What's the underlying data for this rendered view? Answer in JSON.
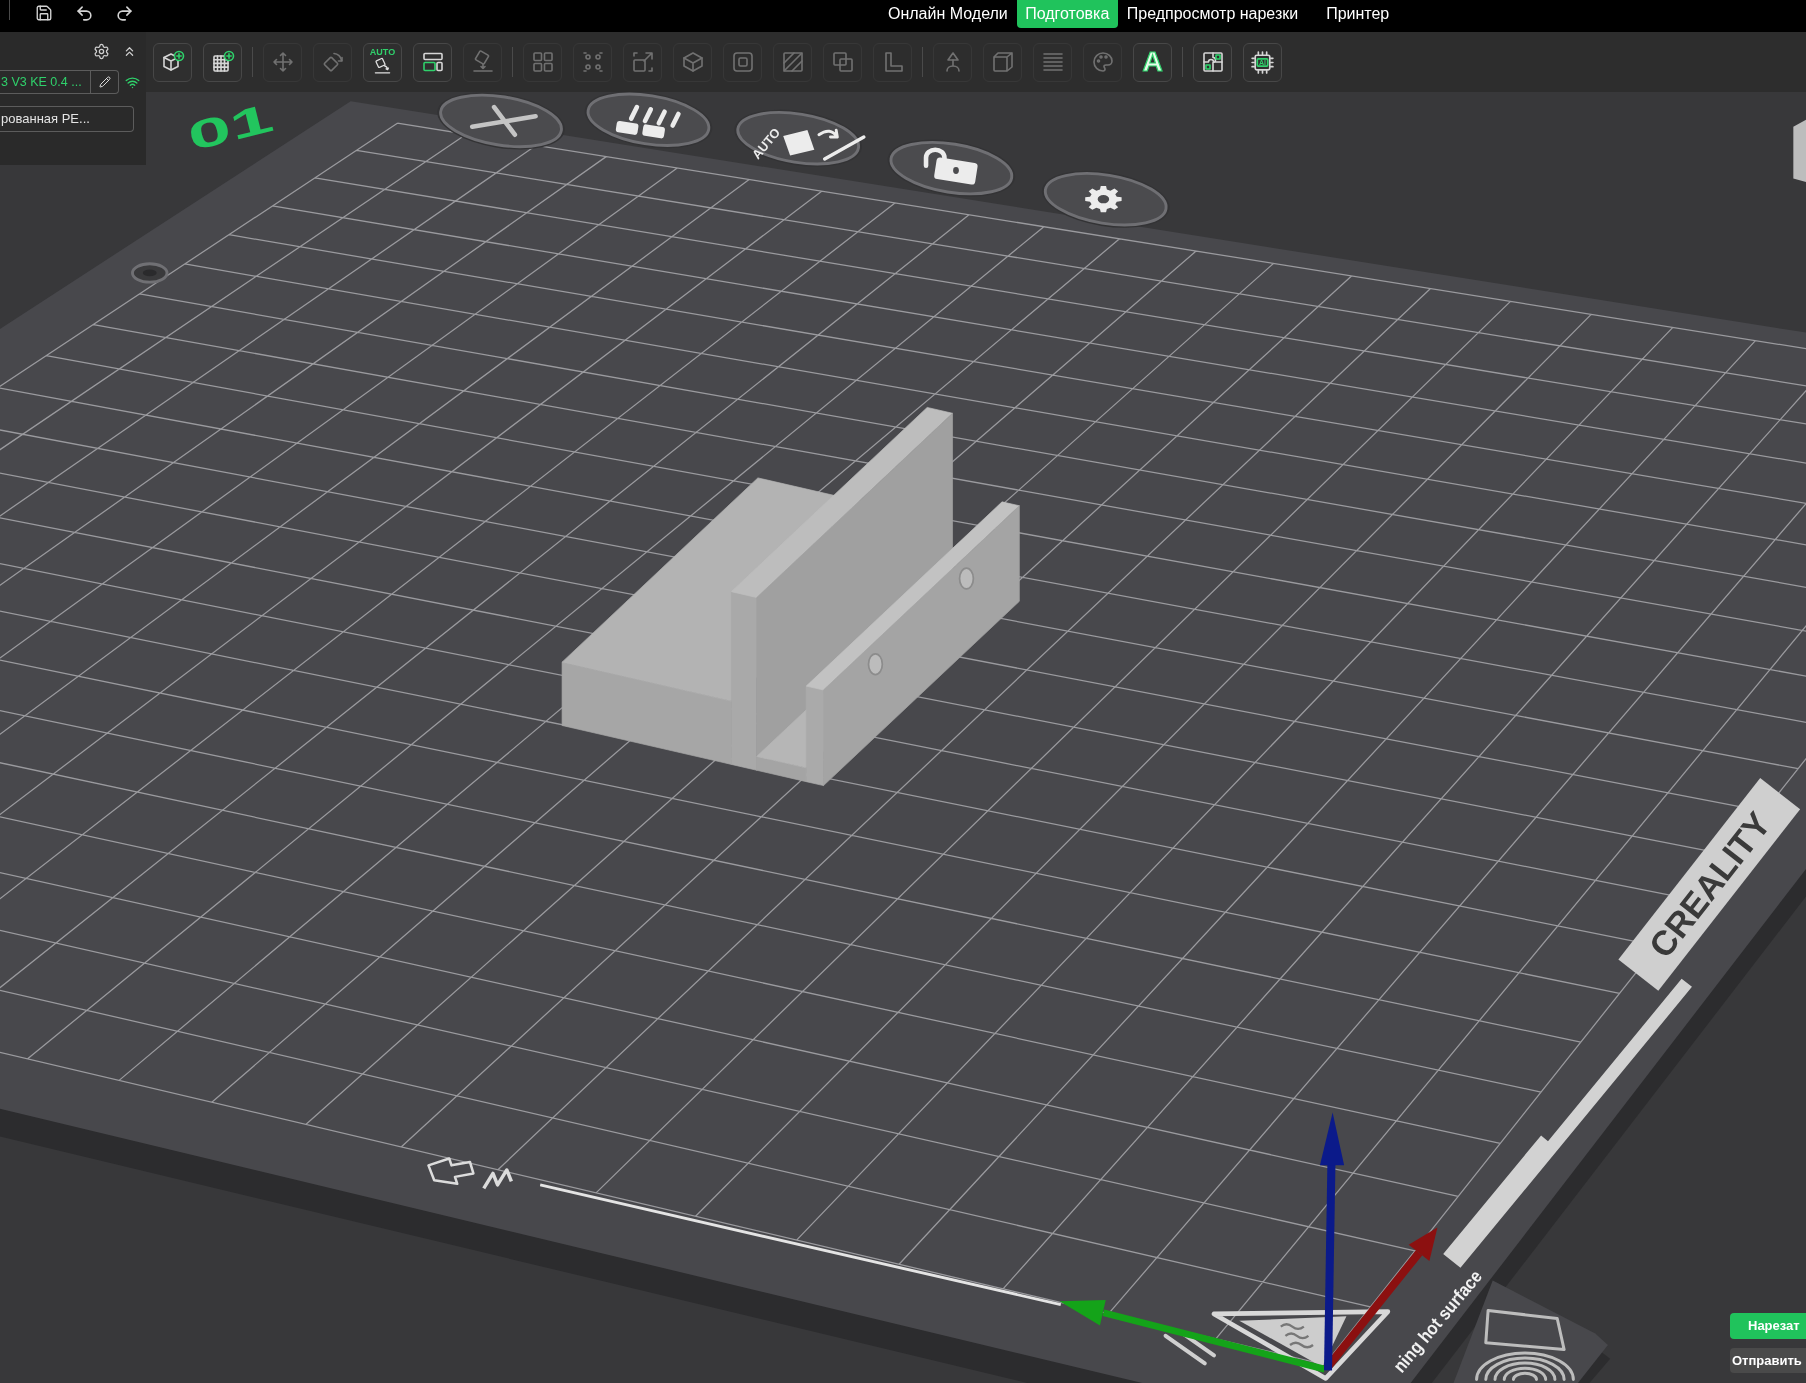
{
  "top_bar": {
    "tabs": [
      {
        "label": "Онлайн Модели",
        "selected": false
      },
      {
        "label": "Подготовка",
        "selected": true
      },
      {
        "label": "Предпросмотр нарезки",
        "selected": false
      },
      {
        "label": "Принтер",
        "selected": false
      }
    ]
  },
  "printer_panel": {
    "printer_name": "3 V3 KE 0.4 ...",
    "plate_type": "рованная PE..."
  },
  "toolbar": {
    "groups": [
      {
        "tools": [
          {
            "disabled": false
          },
          {
            "disabled": false
          }
        ]
      },
      {
        "tools": [
          {
            "disabled": true
          },
          {
            "disabled": true
          },
          {
            "label": "AUTO",
            "disabled": false
          },
          {
            "disabled": false
          },
          {
            "disabled": true
          }
        ]
      },
      {
        "tools": [
          {
            "disabled": true
          },
          {
            "disabled": true
          },
          {
            "disabled": true
          },
          {
            "disabled": true
          },
          {
            "disabled": true
          },
          {
            "disabled": true
          },
          {
            "disabled": true
          },
          {
            "disabled": true
          }
        ]
      },
      {
        "tools": [
          {
            "disabled": true
          },
          {
            "disabled": true
          },
          {
            "disabled": true
          },
          {
            "disabled": true
          },
          {
            "label": "A",
            "disabled": false
          }
        ]
      },
      {
        "tools": [
          {
            "disabled": false
          },
          {
            "label": "AI",
            "disabled": false
          }
        ]
      }
    ]
  },
  "viewport": {
    "plate_number": "01",
    "plate_toolbar": {
      "auto_label": "AUTO",
      "locked": false
    },
    "bed_logo": "CREALITY",
    "bed_warning": "ning hot surface"
  },
  "actions": {
    "slice_button": "Нарезат",
    "send_button": "Отправить"
  }
}
